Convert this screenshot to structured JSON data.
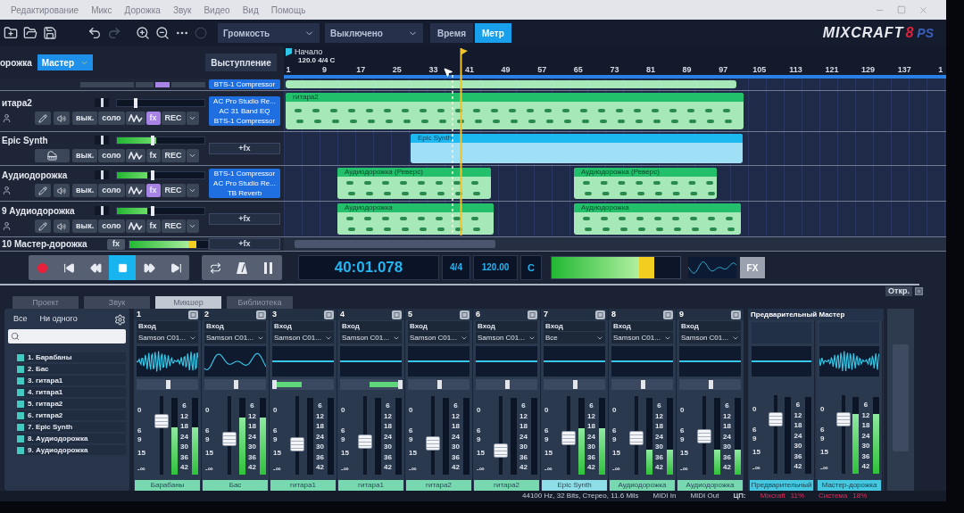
{
  "menu_bar": {
    "items": [
      "Редактирование",
      "Микс",
      "Дорожка",
      "Звук",
      "Видео",
      "Вид",
      "Помощь"
    ]
  },
  "toolbar": {
    "volume_dropdown": "Громкость",
    "snap_dropdown": "Выключено",
    "display_modes": [
      {
        "label": "Время",
        "selected": false
      },
      {
        "label": "Метр",
        "selected": true
      }
    ],
    "logo": {
      "wordmark": "MIXCRAFT",
      "version": "8",
      "edition": "PS"
    }
  },
  "tracks_header": {
    "label": "орожка",
    "output_dropdown": "Мастер",
    "performance_button": "Выступление"
  },
  "ruler": {
    "start_marker": "Начало",
    "project_info": "120.0 4/4 C",
    "bars": [
      "1",
      "9",
      "17",
      "25",
      "33",
      "41",
      "49",
      "57",
      "65",
      "73",
      "81",
      "89",
      "97",
      "105",
      "113",
      "121",
      "129",
      "137",
      "1"
    ]
  },
  "tracks": [
    {
      "kind": "partial",
      "fx_active": true,
      "fx": [
        "BTS-1 Compressor"
      ],
      "clips": [
        {
          "color": "#a6e8b8"
        }
      ]
    },
    {
      "kind": "audio",
      "name": "итара2",
      "pan": {
        "level": 0.5
      },
      "volume": {
        "level": 0.2
      },
      "controls": {
        "mute": "вык.",
        "solo": "соло",
        "fx": "fx",
        "rec": "REC"
      },
      "fx_active": true,
      "fx": [
        "AC Pro Studio Re...",
        "AC 31 Band EQ",
        "BTS-1 Compressor"
      ],
      "clips": [
        {
          "label": "гитара2",
          "color": "#a6e8b8"
        }
      ]
    },
    {
      "kind": "instrument",
      "name": "Epic Synth",
      "pan": {
        "level": 0.5
      },
      "volume": {
        "level": 0.4
      },
      "meter": {
        "level": 0.45
      },
      "controls": {
        "mute": "вык.",
        "solo": "соло",
        "fx": "fx",
        "rec": "REC"
      },
      "fx_active": false,
      "add_fx": "+fx",
      "clips": [
        {
          "label": "Epic Synth",
          "color": "#9fe0f6"
        }
      ]
    },
    {
      "kind": "audio",
      "name": "Аудиодорожка",
      "pan": {
        "level": 0.5
      },
      "volume": {
        "level": 0.4
      },
      "meter": {
        "level": 0.35
      },
      "controls": {
        "mute": "вык.",
        "solo": "соло",
        "fx": "fx",
        "rec": "REC"
      },
      "fx_active": true,
      "fx": [
        "BTS-1 Compressor",
        "AC Pro Studio Re...",
        "TB Reverb"
      ],
      "clips": [
        {
          "label": "Аудиодорожка (Реверс)",
          "color": "#a6e8b8"
        },
        {
          "label": "Аудиодорожка (Реверс)",
          "color": "#a6e8b8"
        }
      ]
    },
    {
      "kind": "audio",
      "name": "9 Аудиодорожка",
      "pan": {
        "level": 0.5
      },
      "volume": {
        "level": 0.4
      },
      "meter": {
        "level": 0.35
      },
      "controls": {
        "mute": "вык.",
        "solo": "соло",
        "fx": "fx",
        "rec": "REC"
      },
      "fx_active": false,
      "add_fx": "+fx",
      "clips": [
        {
          "label": "Аудиодорожка",
          "color": "#a6e8b8"
        },
        {
          "label": "Аудиодорожка",
          "color": "#a6e8b8"
        }
      ]
    },
    {
      "kind": "master",
      "name": "10 Мастер-дорожка",
      "fx_button": "fx",
      "meter": {
        "level": 0.85
      },
      "add_fx": "+fx"
    }
  ],
  "transport": {
    "buttons": [
      {
        "kind": "record",
        "selected": false
      },
      {
        "kind": "to_start",
        "selected": false
      },
      {
        "kind": "rewind",
        "selected": false
      },
      {
        "kind": "stop",
        "selected": true
      },
      {
        "kind": "forward",
        "selected": false
      },
      {
        "kind": "to_end",
        "selected": false
      }
    ],
    "modes": [
      {
        "kind": "loop",
        "selected": false
      },
      {
        "kind": "metronome",
        "selected": false
      },
      {
        "kind": "punch",
        "selected": false
      }
    ],
    "time": "40:01.078",
    "signature": "4/4",
    "tempo": "120.00",
    "key": "C",
    "output_meter": {
      "level": 0.8
    },
    "fx_button": "FX"
  },
  "panel_tabs": {
    "undock_button": "Откр.",
    "tabs": [
      {
        "label": "Проект",
        "selected": false
      },
      {
        "label": "Звук",
        "selected": false
      },
      {
        "label": "Микшер",
        "selected": true
      },
      {
        "label": "Библиотека",
        "selected": false
      }
    ]
  },
  "mixer": {
    "filter": {
      "all_button": "Все",
      "none_button": "Ни одного"
    },
    "track_list": [
      {
        "label": "1. Барабаны",
        "checked": true
      },
      {
        "label": "2. Бас",
        "checked": true
      },
      {
        "label": "3. гитара1",
        "checked": true
      },
      {
        "label": "4. гитара1",
        "checked": true
      },
      {
        "label": "5. гитара2",
        "checked": true
      },
      {
        "label": "6. гитара2",
        "checked": true
      },
      {
        "label": "7. Epic Synth",
        "checked": true
      },
      {
        "label": "8. Аудиодорожка",
        "checked": true
      },
      {
        "label": "9. Аудиодорожка",
        "checked": true
      }
    ],
    "channels": [
      {
        "number": "1",
        "input_label": "Вход",
        "input": "Samson C01...",
        "signal": true,
        "pan": {
          "level": 0.5
        },
        "fader": {
          "level": 0.72
        },
        "fader_scale": [
          "0",
          "6",
          "9",
          "15",
          "-∞"
        ],
        "meter": {
          "level": 0.62
        },
        "meter_scale": [
          "6",
          "12",
          "18",
          "24",
          "30",
          "36",
          "42"
        ],
        "name": "Барабаны",
        "color": "#78d8b0"
      },
      {
        "number": "2",
        "input_label": "Вход",
        "input": "Samson C01...",
        "signal": true,
        "pan": {
          "level": 0.5
        },
        "fader": {
          "level": 0.45
        },
        "fader_scale": [
          "0",
          "6",
          "9",
          "15",
          "-∞"
        ],
        "meter": {
          "level": 0.75
        },
        "meter_scale": [
          "6",
          "12",
          "18",
          "24",
          "30",
          "36",
          "42"
        ],
        "name": "Бас",
        "color": "#78d8b0"
      },
      {
        "number": "3",
        "input_label": "Вход",
        "input": "Samson C01...",
        "signal": false,
        "pan": {
          "level": 0
        },
        "fader": {
          "level": 0.36
        },
        "fader_scale": [
          "0",
          "6",
          "9",
          "15",
          "-∞"
        ],
        "meter_scale": [
          "6",
          "12",
          "18",
          "24",
          "30",
          "36",
          "42"
        ],
        "name": "гитара1",
        "color": "#78d8b0"
      },
      {
        "number": "4",
        "input_label": "Вход",
        "input": "Samson C01...",
        "signal": false,
        "pan": {
          "level": 1
        },
        "fader": {
          "level": 0.4
        },
        "fader_scale": [
          "0",
          "6",
          "9",
          "15",
          "-∞"
        ],
        "meter_scale": [
          "6",
          "12",
          "18",
          "24",
          "30",
          "36",
          "42"
        ],
        "name": "гитара1",
        "color": "#78d8b0"
      },
      {
        "number": "5",
        "input_label": "Вход",
        "input": "Samson C01...",
        "signal": false,
        "pan": {
          "level": 0.5
        },
        "fader": {
          "level": 0.38
        },
        "fader_scale": [
          "0",
          "6",
          "9",
          "15",
          "-∞"
        ],
        "meter_scale": [
          "6",
          "12",
          "18",
          "24",
          "30",
          "36",
          "42"
        ],
        "name": "гитара2",
        "color": "#78d8b0"
      },
      {
        "number": "6",
        "input_label": "Вход",
        "input": "Samson C01...",
        "signal": false,
        "pan": {
          "level": 0.5
        },
        "fader": {
          "level": 0.26
        },
        "fader_scale": [
          "0",
          "6",
          "9",
          "15",
          "-∞"
        ],
        "meter_scale": [
          "6",
          "12",
          "18",
          "24",
          "30",
          "36",
          "42"
        ],
        "name": "гитара2",
        "color": "#78d8b0"
      },
      {
        "number": "7",
        "input_label": "Вход",
        "input": "Все",
        "signal": false,
        "pan": {
          "level": 0.5
        },
        "fader": {
          "level": 0.46
        },
        "fader_scale": [
          "0",
          "6",
          "9",
          "15",
          "-∞"
        ],
        "meter": {
          "level": 0.6
        },
        "meter_scale": [
          "6",
          "12",
          "18",
          "24",
          "30",
          "36",
          "42"
        ],
        "name": "Epic Synth",
        "color": "#8fdde6"
      },
      {
        "number": "8",
        "input_label": "Вход",
        "input": "Samson C01...",
        "signal": false,
        "pan": {
          "level": 0.5
        },
        "fader": {
          "level": 0.46
        },
        "fader_scale": [
          "0",
          "6",
          "9",
          "15",
          "-∞"
        ],
        "meter": {
          "level": 0.32
        },
        "meter_scale": [
          "6",
          "12",
          "18",
          "24",
          "30",
          "36",
          "42"
        ],
        "name": "Аудиодорожка",
        "color": "#78d8b0"
      },
      {
        "number": "9",
        "input_label": "Вход",
        "input": "Samson C01...",
        "signal": false,
        "pan": {
          "level": 0.5
        },
        "fader": {
          "level": 0.48
        },
        "fader_scale": [
          "0",
          "6",
          "9",
          "15",
          "-∞"
        ],
        "meter": {
          "level": 0.33
        },
        "meter_scale": [
          "6",
          "12",
          "18",
          "24",
          "30",
          "36",
          "42"
        ],
        "name": "Аудиодорожка",
        "color": "#78d8b0"
      }
    ],
    "master": {
      "title": "Предварительный Мастер",
      "strips": [
        {
          "signal": false,
          "fader": {
            "level": 0.74
          },
          "fader_scale": [
            "0",
            "6",
            "9",
            "15",
            "-∞"
          ],
          "meter_scale": [
            "6",
            "12",
            "18",
            "24",
            "30",
            "36",
            "42"
          ],
          "name": "Предварительный",
          "color": "#45c8e0"
        },
        {
          "signal": true,
          "fader": {
            "level": 0.74
          },
          "fader_scale": [
            "0",
            "6",
            "9",
            "15",
            "-∞"
          ],
          "meter": {
            "level": 0.78
          },
          "meter_scale": [
            "6",
            "12",
            "18",
            "24",
            "30",
            "36",
            "42"
          ],
          "name": "Мастер-дорожка",
          "color": "#45c8e0"
        }
      ]
    }
  },
  "status_bar": {
    "audio_format": "44100 Hz, 32 Bits, Стерео, 11.6 Mils",
    "midi_in": "MIDI In",
    "midi_out": "MIDI Out",
    "cpu_label": "ЦП:",
    "cpu": [
      {
        "label": "Mixcraft",
        "value": "11%"
      },
      {
        "label": "Система",
        "value": "18%"
      }
    ]
  }
}
